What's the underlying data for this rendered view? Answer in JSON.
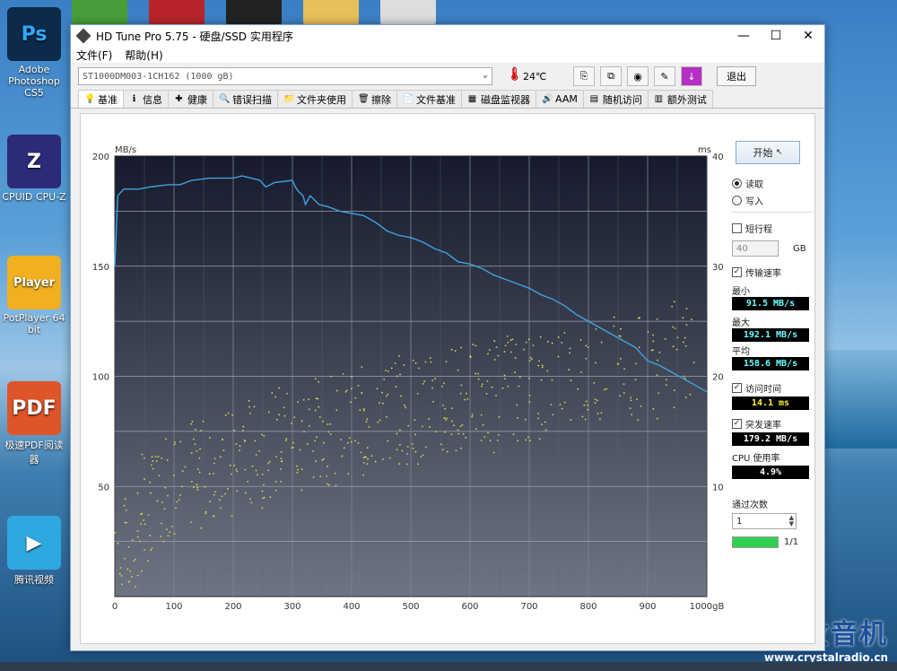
{
  "desktop": {
    "icons": [
      {
        "label": "Adobe\nPhotoshop CS5",
        "glyph": "Ps"
      },
      {
        "label": "CPUID CPU-Z",
        "glyph": "Z"
      },
      {
        "label": "PotPlayer 64 bit",
        "glyph": "Player"
      },
      {
        "label": "极速PDF阅读器",
        "glyph": "PDF"
      },
      {
        "label": "腾讯视频",
        "glyph": "▶"
      }
    ],
    "watermark": {
      "text": "矿石收音机",
      "url": "www.crystalradio.cn"
    }
  },
  "window": {
    "title": "HD Tune Pro 5.75 - 硬盘/SSD 实用程序",
    "menu": [
      "文件(F)",
      "帮助(H)"
    ],
    "drive": "ST1000DM003-1CH162 (1000 gB)",
    "temperature": "24",
    "temperature_unit": "℃",
    "exit_label": "退出",
    "tabs": [
      {
        "label": "基准",
        "icon": "bulb-icon",
        "glyph": "💡",
        "active": true
      },
      {
        "label": "信息",
        "icon": "info-icon",
        "glyph": "ℹ"
      },
      {
        "label": "健康",
        "icon": "health-cross-icon",
        "glyph": "✚"
      },
      {
        "label": "错误扫描",
        "icon": "magnifier-icon",
        "glyph": "🔍"
      },
      {
        "label": "文件夹使用",
        "icon": "folder-icon",
        "glyph": "📁"
      },
      {
        "label": "擦除",
        "icon": "trash-icon",
        "glyph": "🗑"
      },
      {
        "label": "文件基准",
        "icon": "file-benchmark-icon",
        "glyph": "📄"
      },
      {
        "label": "磁盘监视器",
        "icon": "monitor-icon",
        "glyph": "▦"
      },
      {
        "label": "AAM",
        "icon": "speaker-icon",
        "glyph": "🔊"
      },
      {
        "label": "随机访问",
        "icon": "random-access-icon",
        "glyph": "▤"
      },
      {
        "label": "额外测试",
        "icon": "extra-tests-icon",
        "glyph": "▥"
      }
    ]
  },
  "side": {
    "start_label": "开始",
    "read_label": "读取",
    "write_label": "写入",
    "short_stroke_label": "短行程",
    "short_stroke_value": "40",
    "short_stroke_unit": "GB",
    "transfer_rate_label": "传输速率",
    "min_label": "最小",
    "min_value": "91.5 MB/s",
    "max_label": "最大",
    "max_value": "192.1 MB/s",
    "avg_label": "平均",
    "avg_value": "158.6 MB/s",
    "access_time_label": "访问时间",
    "access_time_value": "14.1 ms",
    "burst_label": "突发速率",
    "burst_value": "179.2 MB/s",
    "cpu_label": "CPU 使用率",
    "cpu_value": "4.9%",
    "passes_label": "通过次数",
    "passes_value": "1",
    "progress_text": "1/1",
    "progress_fraction": 1.0
  },
  "chart_data": {
    "type": "line",
    "ylabel": "MB/s",
    "y2label": "ms",
    "xlabel_unit": "gB",
    "ylim": [
      0,
      200
    ],
    "y2lim": [
      0,
      40
    ],
    "xlim": [
      0,
      1000
    ],
    "x_ticks": [
      "0",
      "100",
      "200",
      "300",
      "400",
      "500",
      "600",
      "700",
      "800",
      "900",
      "1000gB"
    ],
    "y_ticks": [
      "200",
      "150",
      "100",
      "50"
    ],
    "y2_ticks": [
      "40",
      "30",
      "20",
      "10"
    ],
    "grid": true,
    "colors": {
      "read": "#3fa3e0",
      "access": "#d8d84a",
      "background_top": "#161a2c",
      "background_bottom": "#6e7482"
    },
    "series": [
      {
        "kind": "read",
        "x": [
          0,
          5,
          15,
          40,
          60,
          90,
          110,
          130,
          160,
          180,
          200,
          215,
          230,
          245,
          255,
          270,
          300,
          305,
          310,
          318,
          322,
          330,
          345,
          360,
          380,
          400,
          420,
          440,
          460,
          480,
          500,
          520,
          540,
          560,
          580,
          600,
          620,
          640,
          660,
          680,
          700,
          720,
          740,
          760,
          780,
          800,
          820,
          840,
          860,
          880,
          900,
          920,
          940,
          960,
          980,
          1000
        ],
        "y": [
          150,
          182,
          185,
          185,
          186,
          187,
          187,
          189,
          190,
          190,
          190,
          191,
          190,
          189,
          186,
          188,
          189,
          186,
          184,
          182,
          178,
          182,
          178,
          177,
          175,
          174,
          173,
          170,
          166,
          164,
          163,
          161,
          158,
          156,
          152,
          151,
          149,
          146,
          144,
          142,
          140,
          137,
          135,
          132,
          128,
          125,
          122,
          119,
          116,
          113,
          107,
          105,
          102,
          99,
          96,
          93
        ]
      },
      {
        "kind": "access_scatter",
        "x": [
          10,
          25,
          40,
          55,
          70,
          90,
          110,
          130,
          150,
          170,
          190,
          210,
          230,
          250,
          270,
          290,
          310,
          330,
          350,
          370,
          390,
          410,
          430,
          450,
          470,
          490,
          510,
          530,
          550,
          570,
          590,
          610,
          630,
          650,
          670,
          690,
          710,
          730,
          760,
          790,
          820,
          850,
          880,
          910,
          940,
          970
        ],
        "y_ms": [
          2,
          4,
          6,
          8,
          9,
          10,
          10,
          11,
          11,
          12,
          12,
          13,
          13,
          13,
          14,
          14,
          14,
          15,
          15,
          15,
          16,
          16,
          16,
          16,
          17,
          17,
          17,
          17,
          17,
          18,
          18,
          18,
          18,
          19,
          19,
          19,
          19,
          20,
          20,
          20,
          21,
          21,
          21,
          21,
          22,
          22
        ]
      }
    ]
  }
}
